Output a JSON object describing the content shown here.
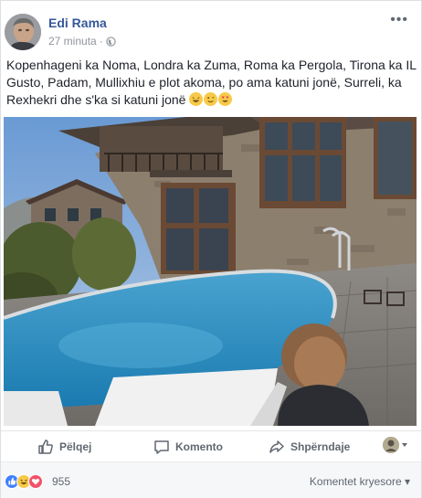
{
  "post": {
    "author": "Edi Rama",
    "time": "27 minuta",
    "separator": "·",
    "privacy_icon": "globe-icon",
    "more_icon": "more-dots-icon",
    "more_label": "•••",
    "text": "Kopenhageni ka Noma, Londra ka Zuma, Roma ka Pergola, Tirona ka IL Gusto, Padam, Mullixhiu e plot akoma, po ama katuni jonë, Surreli, ka Rexhekri dhe s'ka si katuni jonë",
    "emojis": [
      "laughing-emoji",
      "smiling-emoji",
      "heart-eyes-emoji"
    ]
  },
  "actions": {
    "like": "Pëlqej",
    "comment": "Komento",
    "share": "Shpërndaje"
  },
  "reactions": {
    "types": [
      "like",
      "haha",
      "love"
    ],
    "count": "955",
    "sort_label": "Komentet kryesore",
    "sort_icon": "caret-down-icon",
    "sort_caret": "▾"
  },
  "colors": {
    "link": "#365899",
    "meta": "#90949c",
    "action": "#606770",
    "like": "#4080ff",
    "love": "#f25268",
    "haha": "#f7c948"
  }
}
